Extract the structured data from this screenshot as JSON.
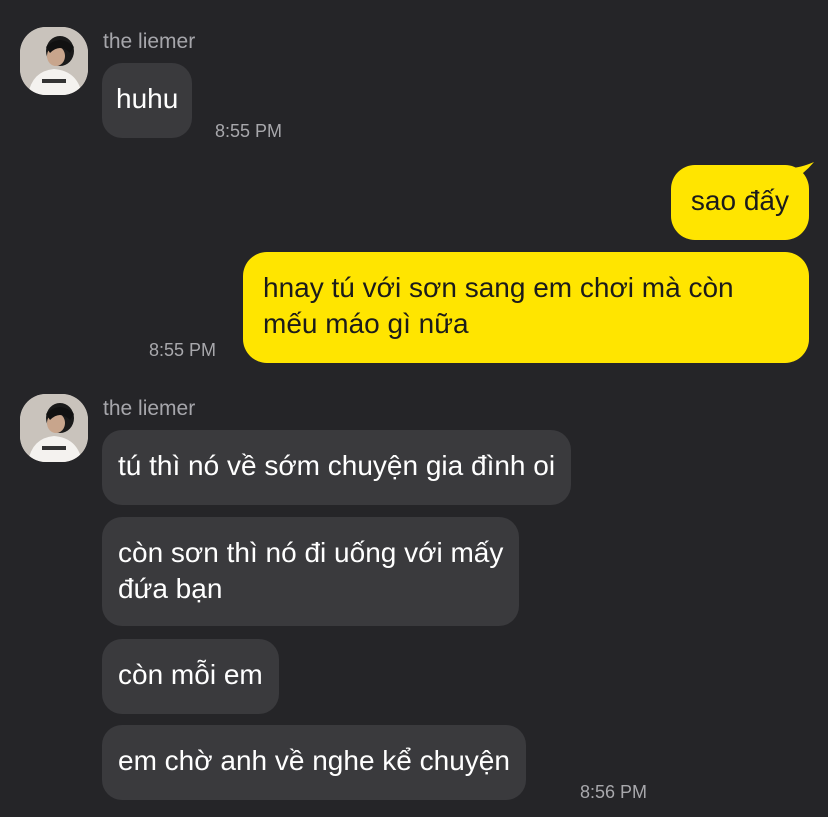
{
  "messages": [
    {
      "sender": "the liemer",
      "text": "huhu",
      "time": "8:55 PM"
    },
    {
      "text": "sao đấy"
    },
    {
      "text_line1": "hnay tú với sơn sang em chơi mà còn",
      "text_line2": "mếu máo gì nữa",
      "time": "8:55 PM"
    },
    {
      "sender": "the liemer",
      "text": "tú thì nó về sớm chuyện gia đình oi"
    },
    {
      "text_line1": "còn sơn thì nó đi uống với mấy",
      "text_line2": "đứa bạn"
    },
    {
      "text": "còn mỗi em"
    },
    {
      "text": "em chờ anh về nghe kể chuyện",
      "time": "8:56 PM"
    }
  ],
  "colors": {
    "background": "#252528",
    "incoming_bubble": "#3a3a3d",
    "outgoing_bubble": "#ffe500"
  },
  "icons": {
    "avatar": "profile-photo"
  }
}
